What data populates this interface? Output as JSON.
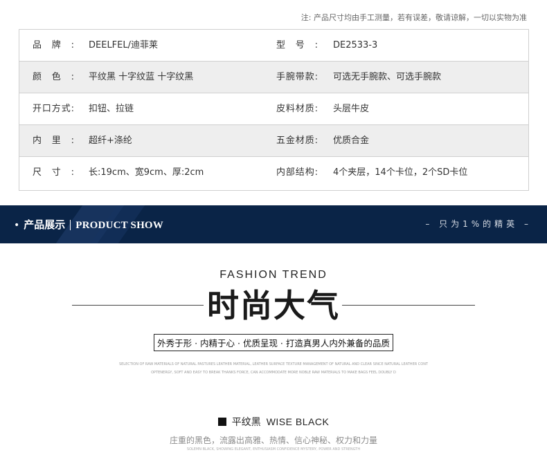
{
  "note": "注: 产品尺寸均由手工测量，若有误差，敬请谅解，一切以实物为准",
  "specs": [
    {
      "left_label": "品牌:",
      "left_value": "DEELFEL/迪菲莱",
      "right_label": "型号:",
      "right_value": "DE2533-3",
      "shaded": false
    },
    {
      "left_label": "颜色:",
      "left_value": "平纹黑  十字纹蓝  十字纹黑",
      "right_label": "手腕带款:",
      "right_value": "可选无手腕款、可选手腕款",
      "shaded": true
    },
    {
      "left_label": "开口方式:",
      "left_value": "扣钮、拉链",
      "right_label": "皮料材质:",
      "right_value": "头层牛皮",
      "shaded": false
    },
    {
      "left_label": "内里:",
      "left_value": "超纤+涤纶",
      "right_label": "五金材质:",
      "right_value": "优质合金",
      "shaded": true
    },
    {
      "left_label": "尺寸:",
      "left_value": "长:19cm、宽9cm、厚:2cm",
      "right_label": "内部结构:",
      "right_value": "4个夹层，14个卡位，2个SD卡位",
      "shaded": false
    }
  ],
  "banner": {
    "bullet": "•",
    "title_cn": "产品展示",
    "title_en": "PRODUCT SHOW",
    "tagline": "– 只为1%的精英 –",
    "bg_color": "#0a2447"
  },
  "fashion": {
    "title_en": "FASHION TREND",
    "title_cn": "时尚大气",
    "slogan": "外秀于形 · 内精于心 · 优质呈现 · 打造真男人内外兼备的品质",
    "fine_line1": "SELECTION OF RAW MATERIALS OF NATURAL PASTURES LEATHER MATERIAL, LEATHER SURFACE TEXTURE MANAGEMENT OF NATURAL AND CLEAR SINCE NATURAL LEATHER CONT",
    "fine_line2": "OPTENERGY, SOFT AND EASY TO BREAK THANKS FORCE, CAN ACCOMMODATE MORE NOBLE RAW MATERIALS TO MAKE BAGS FEEL DOUBLY D"
  },
  "color_section": {
    "name_cn": "平纹黑",
    "name_en": "WISE BLACK",
    "desc_cn": "庄重的黑色，流露出高雅、热情、信心神秘、权力和力量",
    "desc_en": "SOLEMN BLACK, SHOWING ELEGANT, ENTHUSIASM CONFIDENCE MYSTERY, POWER AND STRENGTH"
  }
}
